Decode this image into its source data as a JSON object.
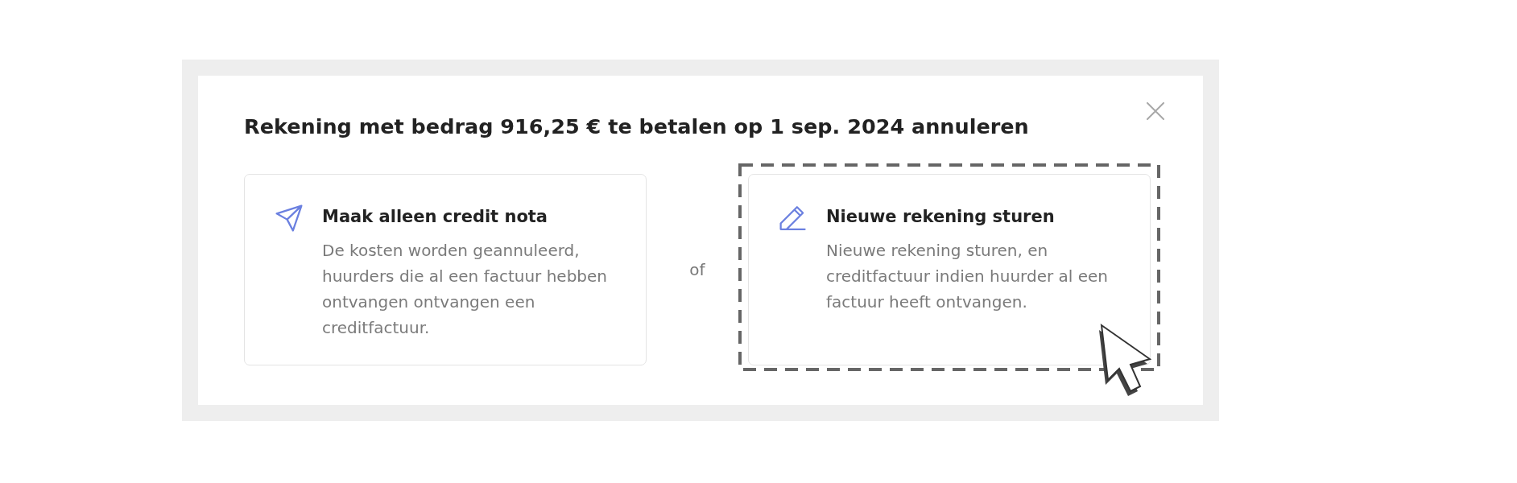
{
  "dialog": {
    "title": "Rekening met bedrag 916,25 € te betalen op 1 sep. 2024 annuleren"
  },
  "options": [
    {
      "kind": "credit",
      "heading": "Maak alleen credit nota",
      "description": "De kosten worden geannuleerd, huurders die al een factuur hebben ontvangen ontvangen een creditfactuur.",
      "highlighted": false,
      "pointer": false
    },
    {
      "kind": "reissue",
      "heading": "Nieuwe rekening sturen",
      "description": "Nieuwe rekening sturen, en creditfactuur indien huurder al een factuur heeft ontvangen.",
      "highlighted": true,
      "pointer": true
    }
  ],
  "separator": "of"
}
